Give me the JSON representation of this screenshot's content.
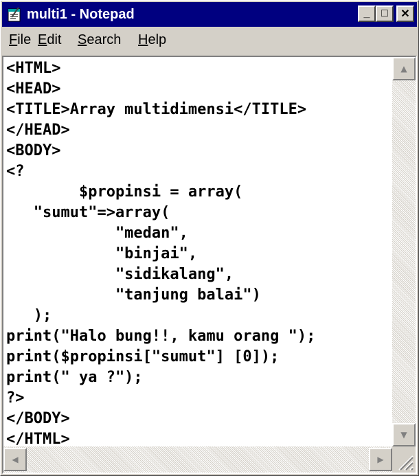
{
  "window": {
    "title": "multi1 - Notepad",
    "titlebar_color": "#000080",
    "buttons": {
      "minimize": "_",
      "maximize": "□",
      "close": "✕"
    }
  },
  "menu": {
    "items": [
      {
        "accel": "F",
        "rest": "ile"
      },
      {
        "accel": "E",
        "rest": "dit"
      },
      {
        "accel": "S",
        "rest": "earch"
      },
      {
        "accel": "H",
        "rest": "elp"
      }
    ]
  },
  "editor": {
    "lines": [
      "<HTML>",
      "<HEAD>",
      "<TITLE>Array multidimensi</TITLE>",
      "</HEAD>",
      "<BODY>",
      "<?",
      "        $propinsi = array(",
      "   \"sumut\"=>array(",
      "            \"medan\",",
      "            \"binjai\",",
      "            \"sidikalang\",",
      "            \"tanjung balai\")",
      "   );",
      "print(\"Halo bung!!, kamu orang \");",
      "print($propinsi[\"sumut\"] [0]);",
      "print(\" ya ?\");",
      "?>",
      "</BODY>",
      "</HTML>"
    ]
  },
  "scrollbars": {
    "up_arrow": "▲",
    "down_arrow": "▼",
    "left_arrow": "◀",
    "right_arrow": "▶"
  },
  "icons": {
    "app": "notepad-icon",
    "grip": "resize-grip-icon"
  }
}
